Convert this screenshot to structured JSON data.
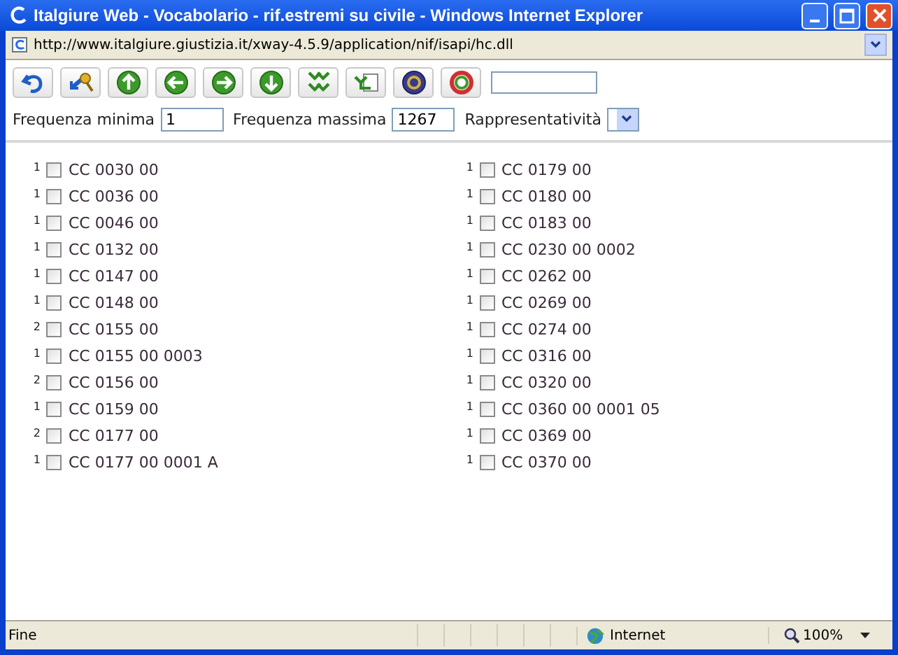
{
  "window": {
    "title": "Italgiure Web - Vocabolario - rif.estremi su civile - Windows Internet Explorer"
  },
  "address_bar": {
    "url": "http://www.italgiure.giustizia.it/xway-4.5.9/application/nif/isapi/hc.dll"
  },
  "toolbar": {
    "buttons": [
      {
        "kind": "undo"
      },
      {
        "kind": "keys"
      },
      {
        "kind": "up"
      },
      {
        "kind": "left"
      },
      {
        "kind": "right"
      },
      {
        "kind": "down"
      },
      {
        "kind": "expand"
      },
      {
        "kind": "swap"
      },
      {
        "kind": "help"
      },
      {
        "kind": "refresh"
      }
    ]
  },
  "filters": [
    {
      "kind": "text",
      "label": "Frequenza minima",
      "value": "1"
    },
    {
      "kind": "text",
      "label": "Frequenza massima",
      "value": "1267"
    },
    {
      "kind": "select",
      "label": "Rappresentatività"
    }
  ],
  "terms": [
    [
      {
        "count": "1",
        "label": "CC 0030 00",
        "checked": false
      },
      {
        "count": "1",
        "label": "CC 0036 00",
        "checked": false
      },
      {
        "count": "1",
        "label": "CC 0046 00",
        "checked": false
      },
      {
        "count": "1",
        "label": "CC 0132 00",
        "checked": false
      },
      {
        "count": "1",
        "label": "CC 0147 00",
        "checked": false
      },
      {
        "count": "1",
        "label": "CC 0148 00",
        "checked": false
      },
      {
        "count": "2",
        "label": "CC 0155 00",
        "checked": false
      },
      {
        "count": "1",
        "label": "CC 0155 00 0003",
        "checked": false
      },
      {
        "count": "2",
        "label": "CC 0156 00",
        "checked": false
      },
      {
        "count": "1",
        "label": "CC 0159 00",
        "checked": false
      },
      {
        "count": "2",
        "label": "CC 0177 00",
        "checked": false
      },
      {
        "count": "1",
        "label": "CC 0177 00 0001 A",
        "checked": false
      }
    ],
    [
      {
        "count": "1",
        "label": "CC 0179 00",
        "checked": false
      },
      {
        "count": "1",
        "label": "CC 0180 00",
        "checked": false
      },
      {
        "count": "1",
        "label": "CC 0183 00",
        "checked": false
      },
      {
        "count": "1",
        "label": "CC 0230 00 0002",
        "checked": false
      },
      {
        "count": "1",
        "label": "CC 0262 00",
        "checked": false
      },
      {
        "count": "1",
        "label": "CC 0269 00",
        "checked": false
      },
      {
        "count": "1",
        "label": "CC 0274 00",
        "checked": false
      },
      {
        "count": "1",
        "label": "CC 0316 00",
        "checked": false
      },
      {
        "count": "1",
        "label": "CC 0320 00",
        "checked": false
      },
      {
        "count": "1",
        "label": "CC 0360 00 0001 05",
        "checked": false
      },
      {
        "count": "1",
        "label": "CC 0369 00",
        "checked": false
      },
      {
        "count": "1",
        "label": "CC 0370 00",
        "checked": false
      }
    ]
  ],
  "status_bar": {
    "text": "Fine",
    "zone": "Internet",
    "zoom": "100%"
  }
}
